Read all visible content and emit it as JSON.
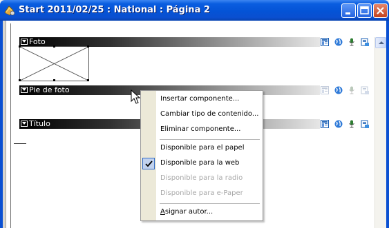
{
  "window": {
    "title": "Start 2011/02/25 : National : Página 2",
    "controls": [
      "minimize",
      "maximize",
      "close"
    ]
  },
  "sections": [
    {
      "label": "Foto",
      "icons": [
        "layout-icon",
        "globe-icon",
        "microphone-icon",
        "epaper-icon"
      ],
      "icons_active": true
    },
    {
      "label": "Pie de foto",
      "icons": [
        "layout-icon",
        "globe-icon",
        "microphone-icon",
        "epaper-icon"
      ],
      "icons_active": false
    },
    {
      "label": "Título",
      "icons": [
        "layout-icon",
        "globe-icon",
        "microphone-icon",
        "epaper-icon"
      ],
      "icons_active": true
    }
  ],
  "context_menu": {
    "items": [
      {
        "label": "Insertar componente...",
        "enabled": true,
        "checked": false
      },
      {
        "label": "Cambiar tipo de contenido...",
        "enabled": true,
        "checked": false
      },
      {
        "label": "Eliminar componente...",
        "enabled": true,
        "checked": false
      },
      {
        "label": "Disponible para el papel",
        "enabled": true,
        "checked": false
      },
      {
        "label": "Disponible para la web",
        "enabled": true,
        "checked": true
      },
      {
        "label": "Disponible para la radio",
        "enabled": false,
        "checked": false
      },
      {
        "label": "Disponible para e-Paper",
        "enabled": false,
        "checked": false
      },
      {
        "label": "Asignar autor...",
        "enabled": true,
        "checked": false,
        "mnemonic": "A"
      }
    ]
  },
  "colors": {
    "titlebar": "#0453d6",
    "menu_gutter": "#ece9d8",
    "check_highlight": "#c1d2ee",
    "disabled_text": "#a8a8a8"
  }
}
